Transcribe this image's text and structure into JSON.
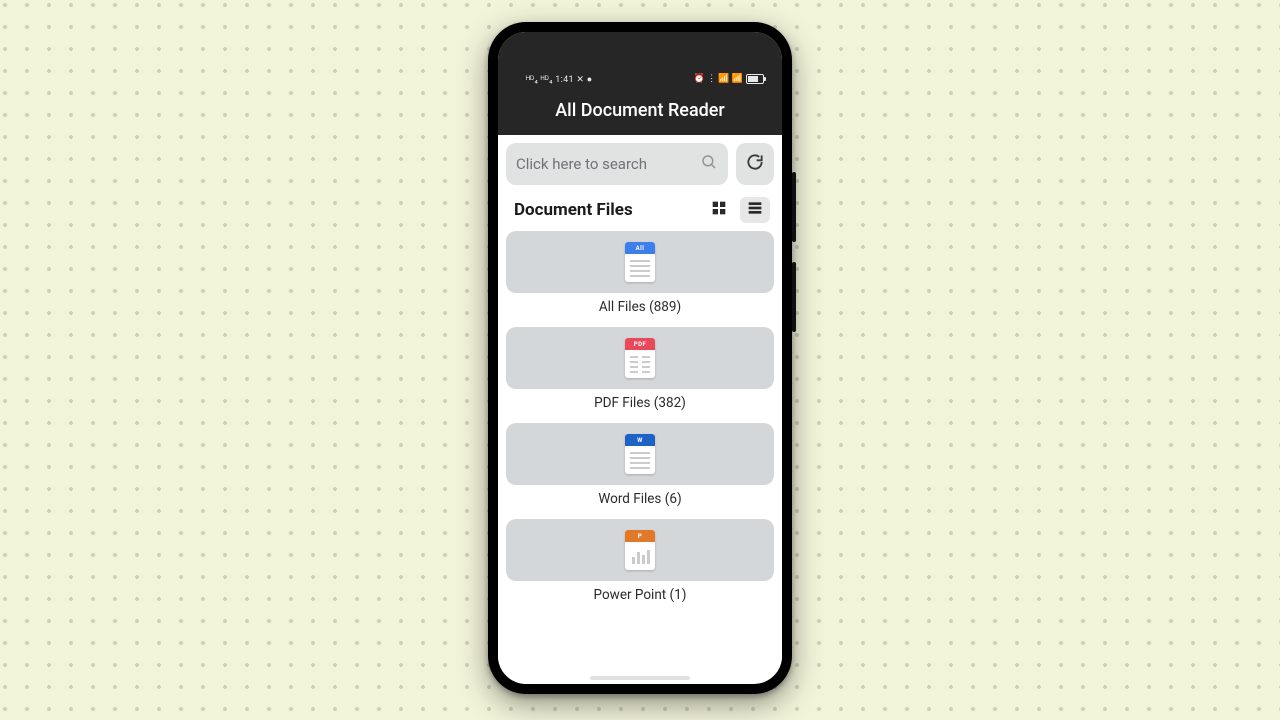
{
  "status": {
    "time": "1:41",
    "left_extra": "ᴴᴰ₄ ᴴᴰ₄",
    "right_icons": "⏰ ⋮ 📶 📶"
  },
  "header": {
    "app_title": "All Document Reader"
  },
  "search": {
    "placeholder": "Click here to search"
  },
  "section": {
    "title": "Document Files"
  },
  "categories": [
    {
      "name": "All Files",
      "count": 889,
      "tab_label": "All",
      "tab_class": "tab-all",
      "style": "full"
    },
    {
      "name": "PDF Files",
      "count": 382,
      "tab_label": "PDF",
      "tab_class": "tab-pdf",
      "style": "split"
    },
    {
      "name": "Word Files",
      "count": 6,
      "tab_label": "W",
      "tab_class": "tab-word",
      "style": "full"
    },
    {
      "name": "Power Point",
      "count": 1,
      "tab_label": "P",
      "tab_class": "tab-ppt",
      "style": "chart"
    }
  ]
}
